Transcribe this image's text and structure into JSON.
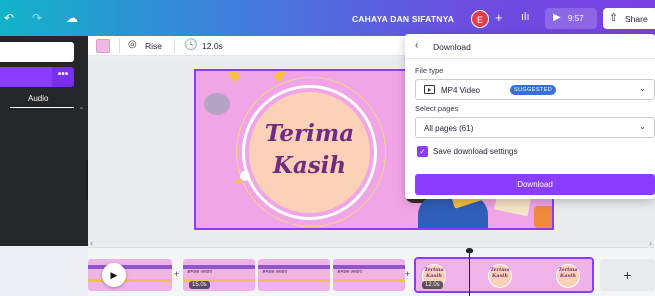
{
  "topbar": {
    "title": "CAHAYA DAN SIFATNYA",
    "avatar_initial": "E",
    "play_time": "9:57",
    "share_label": "Share"
  },
  "left_panel": {
    "audio_tab_label": "Audio",
    "more_label": "•••"
  },
  "toolbar": {
    "animation_label": "Rise",
    "duration_label": "12.0s",
    "swatch_color": "#f2b8e6"
  },
  "slide": {
    "line1": "Terima",
    "line2": "Kasih"
  },
  "download_panel": {
    "title": "Download",
    "file_type_label": "File type",
    "file_type_value": "MP4 Video",
    "suggested_badge": "SUGGESTED",
    "select_pages_label": "Select pages",
    "pages_value": "All pages (61)",
    "save_settings_label": "Save download settings",
    "save_settings_checked": true,
    "download_button": "Download"
  },
  "timeline": {
    "clips": [
      {
        "label": "",
        "duration": "15.0s"
      },
      {
        "label": "अभ्यास अध्याय",
        "duration": ""
      },
      {
        "label": "अभ्यास अध्याय",
        "duration": ""
      },
      {
        "label": "अभ्यास अध्याय",
        "duration": ""
      }
    ],
    "selected_duration": "12.0s",
    "selected_mini_text": "Terima Kasih",
    "add_page_label": "+"
  },
  "colors": {
    "accent": "#8b3dff",
    "badge": "#3a6fd8"
  }
}
